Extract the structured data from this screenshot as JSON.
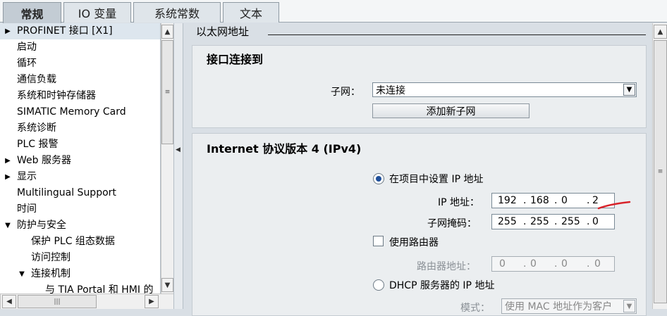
{
  "tabs": [
    "常规",
    "IO 变量",
    "系统常数",
    "文本"
  ],
  "tree": {
    "items": [
      {
        "label": "PROFINET 接口 [X1]",
        "arrow": "right",
        "selected": true
      },
      {
        "label": "启动"
      },
      {
        "label": "循环"
      },
      {
        "label": "通信负载"
      },
      {
        "label": "系统和时钟存储器"
      },
      {
        "label": "SIMATIC Memory Card"
      },
      {
        "label": "系统诊断"
      },
      {
        "label": "PLC 报警"
      },
      {
        "label": "Web 服务器",
        "arrow": "right"
      },
      {
        "label": "显示",
        "arrow": "right"
      },
      {
        "label": "Multilingual Support"
      },
      {
        "label": "时间"
      },
      {
        "label": "防护与安全",
        "arrow": "down"
      },
      {
        "label": "保护 PLC 组态数据"
      },
      {
        "label": "访问控制"
      },
      {
        "label": "连接机制",
        "arrow": "down"
      },
      {
        "label": "与 TIA Portal 和 HMI 的"
      }
    ]
  },
  "ethernet": {
    "header": "以太网地址",
    "connect_section": {
      "title": "接口连接到",
      "subnet_label": "子网：",
      "subnet_value": "未连接",
      "add_subnet_button": "添加新子网"
    },
    "ipv4_section": {
      "title": "Internet 协议版本 4 (IPv4)",
      "set_ip_in_project_label": "在项目中设置 IP 地址",
      "set_ip_in_project_selected": true,
      "ip_label": "IP 地址：",
      "ip_octets": [
        "192",
        "168",
        "0",
        "2"
      ],
      "subnet_mask_label": "子网掩码：",
      "subnet_mask_octets": [
        "255",
        "255",
        "255",
        "0"
      ],
      "use_router_label": "使用路由器",
      "use_router_checked": false,
      "router_label": "路由器地址：",
      "router_octets": [
        "0",
        "0",
        "0",
        "0"
      ],
      "dhcp_label": "DHCP 服务器的 IP 地址",
      "dhcp_selected": false,
      "mode_label": "模式：",
      "mode_value": "使用 MAC 地址作为客户"
    }
  },
  "colors": {
    "annotation_red": "#d8232a",
    "radio_dot": "#1f4f9a"
  }
}
